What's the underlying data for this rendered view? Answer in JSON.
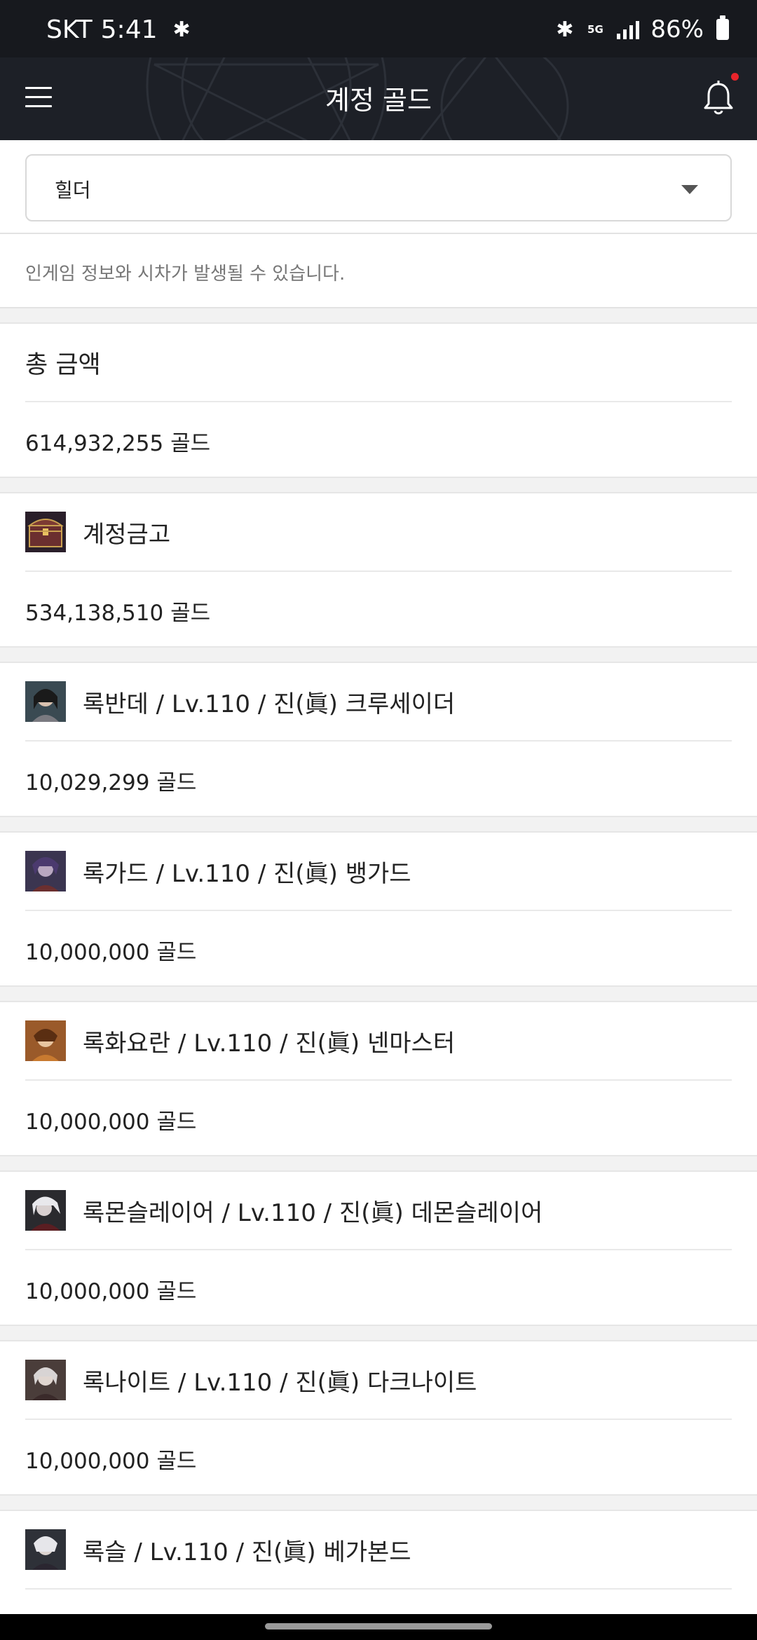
{
  "status_bar": {
    "carrier": "SKT",
    "time": "5:41",
    "network": "5G",
    "battery": "86%"
  },
  "header": {
    "title": "계정 골드",
    "has_notification": true
  },
  "server_select": {
    "value": "힐더"
  },
  "notice": "인게임 정보와 시차가 발생될 수 있습니다.",
  "total": {
    "label": "총 금액",
    "amount": "614,932,255 골드"
  },
  "vault": {
    "label": "계정금고",
    "amount": "534,138,510 골드",
    "icon": "treasure-chest-icon"
  },
  "characters": [
    {
      "label": "록반데 / Lv.110 / 진(眞) 크루세이더",
      "amount": "10,029,299 골드",
      "avatar_color": "#3a4a52"
    },
    {
      "label": "록가드 / Lv.110 / 진(眞) 뱅가드",
      "amount": "10,000,000 골드",
      "avatar_color": "#3b3550"
    },
    {
      "label": "록화요란 / Lv.110 / 진(眞) 넨마스터",
      "amount": "10,000,000 골드",
      "avatar_color": "#9a5a2a"
    },
    {
      "label": "록몬슬레이어 / Lv.110 / 진(眞) 데몬슬레이어",
      "amount": "10,000,000 골드",
      "avatar_color": "#2a2a2e"
    },
    {
      "label": "록나이트 / Lv.110 / 진(眞) 다크나이트",
      "amount": "10,000,000 골드",
      "avatar_color": "#4a3d3a"
    },
    {
      "label": "록슬 / Lv.110 / 진(眞) 베가본드",
      "amount": "",
      "avatar_color": "#2e3138"
    }
  ]
}
